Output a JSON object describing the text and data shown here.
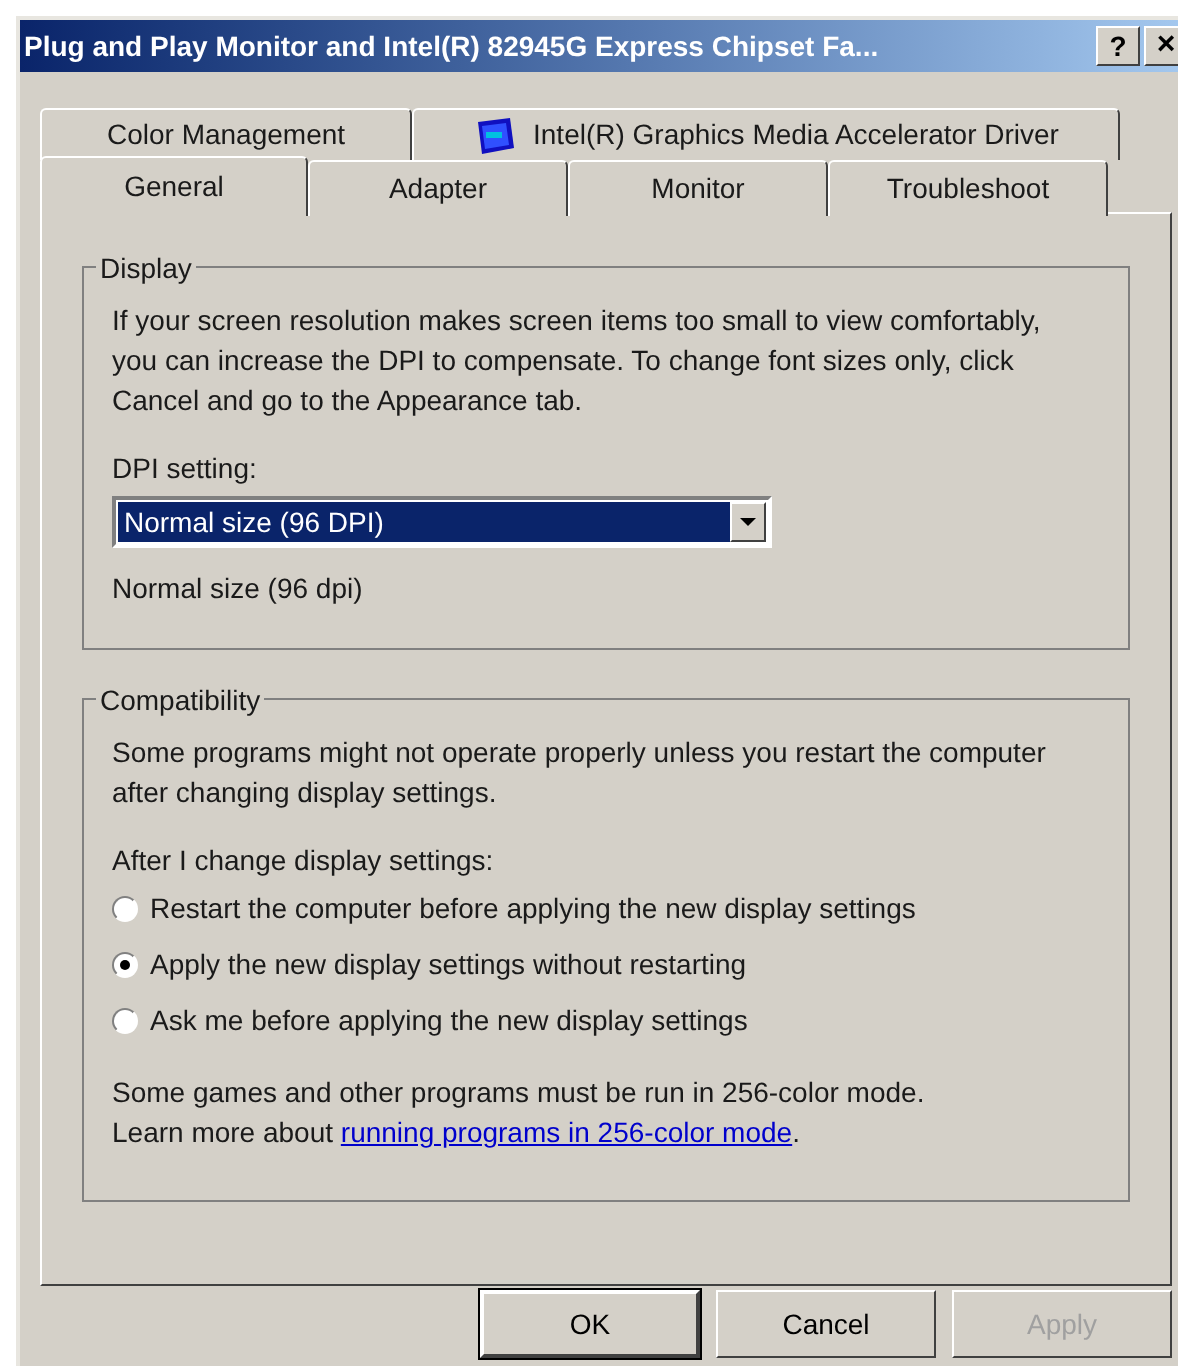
{
  "window": {
    "title": "Plug and Play Monitor and Intel(R) 82945G Express Chipset Fa...",
    "help": "?",
    "close": "×"
  },
  "tab_rows": [
    [
      {
        "label": "Color Management",
        "selected": false
      },
      {
        "label": "Intel(R) Graphics Media Accelerator Driver",
        "selected": false,
        "kind": "icon"
      }
    ],
    [
      {
        "label": "General",
        "selected": true
      },
      {
        "label": "Adapter",
        "selected": false
      },
      {
        "label": "Monitor",
        "selected": false
      },
      {
        "label": "Troubleshoot",
        "selected": false
      }
    ]
  ],
  "display": {
    "title": "Display",
    "description": "If your screen resolution makes screen items too small to view comfortably, you can increase the DPI to compensate.  To change font sizes only, click Cancel and go to the Appearance tab.",
    "dpi_label": "DPI setting:",
    "dpi_value": "Normal size (96 DPI)",
    "dpi_caption": "Normal size (96 dpi)"
  },
  "compatibility": {
    "title": "Compatibility",
    "description": "Some programs might not operate properly unless you restart the computer after changing display settings.",
    "options_label": "After I change display settings:",
    "options": [
      {
        "label": "Restart the computer before applying the new display settings",
        "selected": false
      },
      {
        "label": "Apply the new display settings without restarting",
        "selected": true
      },
      {
        "label": "Ask me before applying the new display settings",
        "selected": false
      }
    ],
    "note": "Some games and other programs must be run in 256-color mode.",
    "note_prefix": "Learn more about ",
    "note_link": "running programs in 256-color mode",
    "note_suffix": "."
  },
  "buttons": [
    {
      "label": "OK",
      "disabled": false,
      "default": true
    },
    {
      "label": "Cancel",
      "disabled": false,
      "default": false
    },
    {
      "label": "Apply",
      "disabled": true,
      "default": false
    }
  ]
}
